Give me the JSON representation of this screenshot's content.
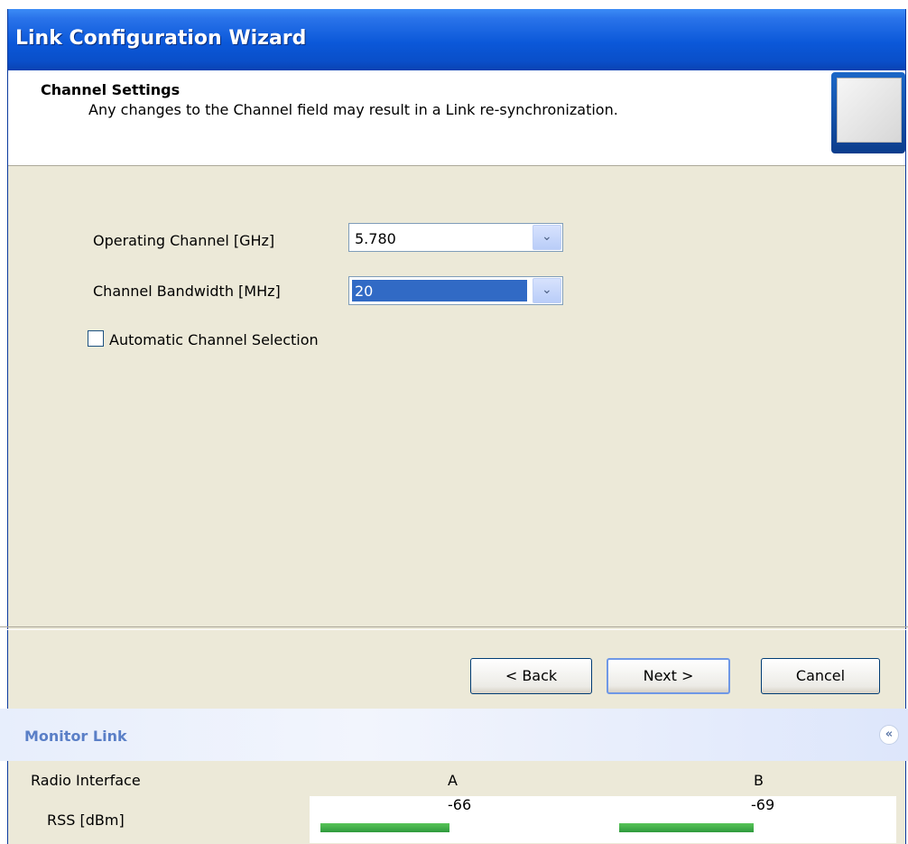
{
  "window": {
    "title": "Link Configuration Wizard"
  },
  "header": {
    "title": "Channel Settings",
    "subtitle": "Any changes to the Channel field may result in a Link re-synchronization."
  },
  "form": {
    "operating_channel_label": "Operating Channel [GHz]",
    "operating_channel_value": "5.780",
    "bandwidth_label": "Channel Bandwidth [MHz]",
    "bandwidth_value": "20",
    "auto_channel_label": "Automatic Channel Selection",
    "auto_channel_checked": false
  },
  "buttons": {
    "back": "< Back",
    "next": "Next >",
    "cancel": "Cancel"
  },
  "monitor": {
    "title": "Monitor Link",
    "radio_interface_label": "Radio Interface",
    "col_a": "A",
    "col_b": "B",
    "rss_label": "RSS [dBm]",
    "rss_a": "-66",
    "rss_b": "-69"
  },
  "colors": {
    "title_bar": "#0b58d9",
    "selection": "#316ac5",
    "rss_bar": "#3aa548"
  },
  "icons": {
    "dropdown": "chevron-down-icon",
    "collapse": "double-chevron-up-icon"
  }
}
